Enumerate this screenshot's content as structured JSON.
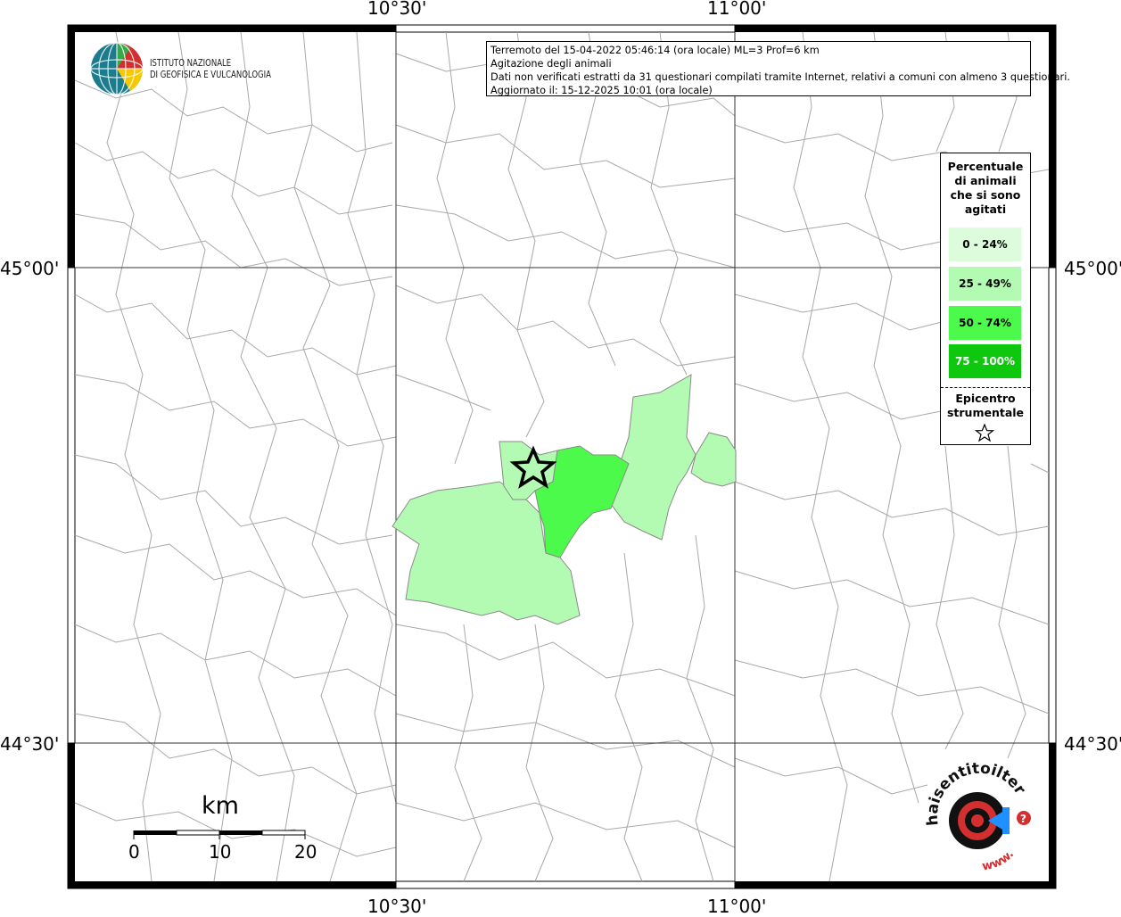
{
  "axes": {
    "top": [
      "10°30'",
      "11°00'"
    ],
    "bottom": [
      "10°30'",
      "11°00'"
    ],
    "left": [
      "45°00'",
      "44°30'"
    ],
    "right": [
      "45°00'",
      "44°30'"
    ]
  },
  "info": {
    "line1": "Terremoto del 15-04-2022 05:46:14 (ora locale) ML=3 Prof=6 km",
    "line2": "Agitazione degli animali",
    "line3": "Dati non verificati estratti da 31 questionari compilati tramite Internet, relativi a comuni con almeno 3 questionari.",
    "line4": "Aggiornato il: 15-12-2025 10:01 (ora locale)"
  },
  "ingv_logo": {
    "line1": "ISTITUTO NAZIONALE",
    "line2": "DI GEOFISICA E VULCANOLOGIA"
  },
  "legend": {
    "title_lines": [
      "Percentuale",
      "di animali",
      "che si sono",
      "agitati"
    ],
    "classes": [
      {
        "label": "0 - 24%",
        "color": "#dcfcdc"
      },
      {
        "label": "25 - 49%",
        "color": "#b3fbb3"
      },
      {
        "label": "50 - 74%",
        "color": "#4cfa4c"
      },
      {
        "label": "75 - 100%",
        "color": "#0ec80e"
      }
    ],
    "epicenter_lines": [
      "Epicentro",
      "strumentale"
    ],
    "epicenter_icon": "star-icon"
  },
  "scale": {
    "unit": "km",
    "labels": [
      "0",
      "10",
      "20"
    ]
  },
  "hst_logo": {
    "text": "haisentitoilterremoto.it",
    "url_text": "www."
  },
  "colors": {
    "light_green": "#b3fbb3",
    "mid_green": "#4cfa4c",
    "borders": "#9a9a9a"
  }
}
